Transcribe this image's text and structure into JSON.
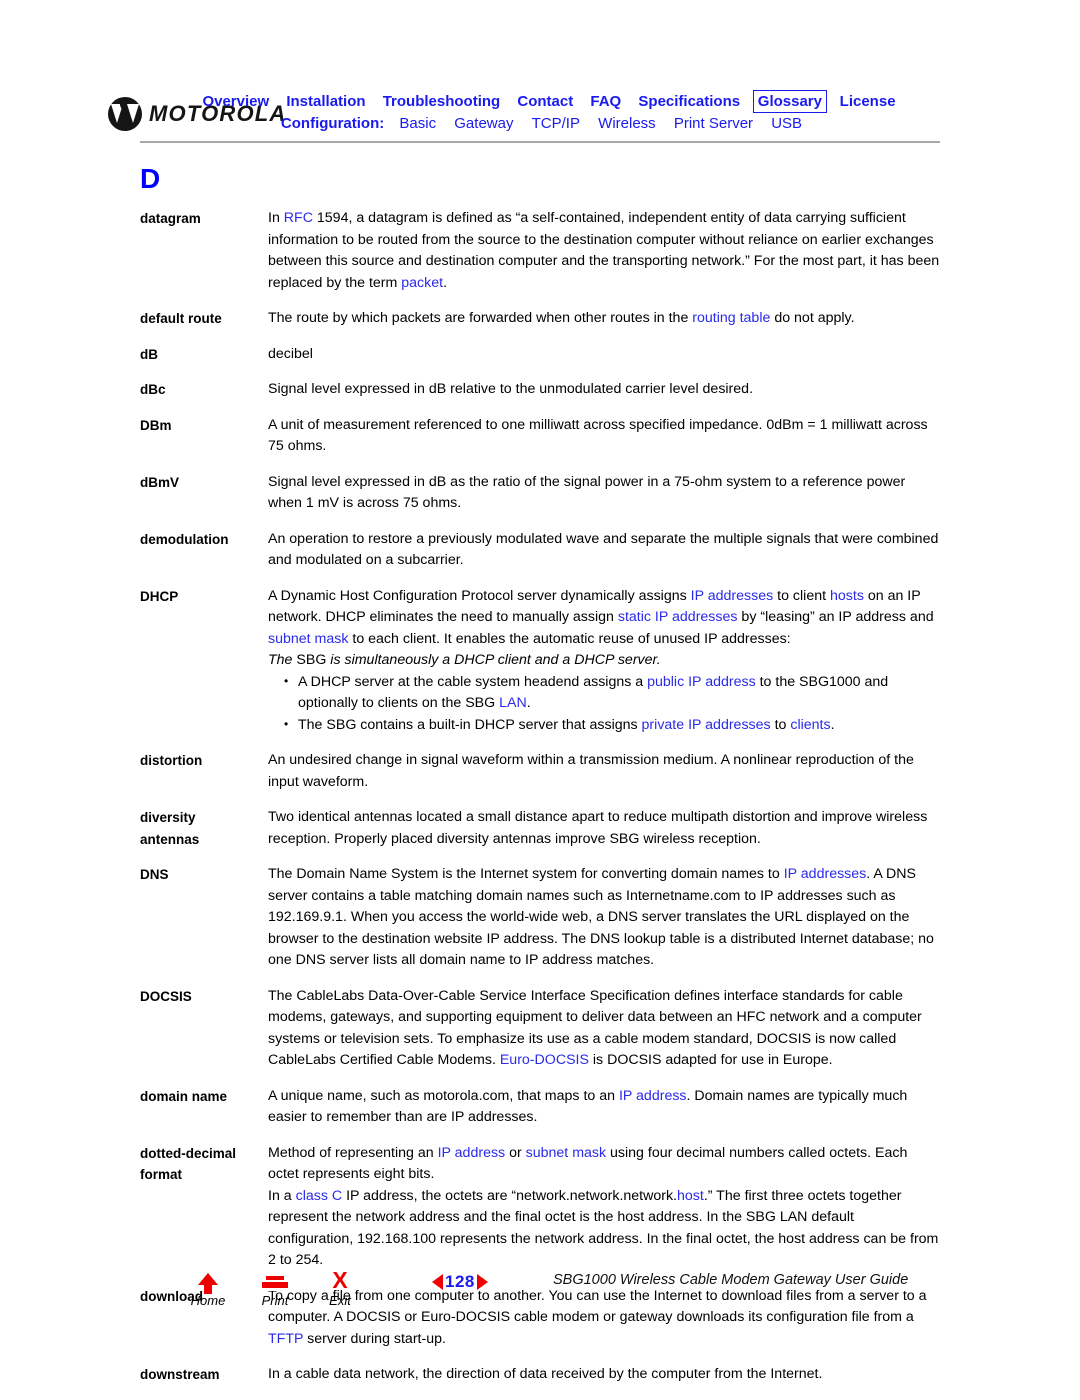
{
  "header": {
    "brand": "MOTOROLA",
    "nav_primary": [
      {
        "label": "Overview",
        "boxed": false
      },
      {
        "label": "Installation",
        "boxed": false
      },
      {
        "label": "Troubleshooting",
        "boxed": false
      },
      {
        "label": "Contact",
        "boxed": false
      },
      {
        "label": "FAQ",
        "boxed": false
      },
      {
        "label": "Specifications",
        "boxed": false
      },
      {
        "label": "Glossary",
        "boxed": true
      },
      {
        "label": "License",
        "boxed": false
      }
    ],
    "nav_secondary_label": "Configuration:",
    "nav_secondary": [
      {
        "label": "Basic"
      },
      {
        "label": "Gateway"
      },
      {
        "label": "TCP/IP"
      },
      {
        "label": "Wireless"
      },
      {
        "label": "Print Server"
      },
      {
        "label": "USB"
      }
    ],
    "link_color": "#1a1aee"
  },
  "content": {
    "letter_heading": "D",
    "entries": [
      {
        "term_lines": [
          "datagram"
        ],
        "blocks": [
          {
            "type": "paragraph",
            "runs": [
              {
                "t": "In "
              },
              {
                "t": "RFC",
                "link": true
              },
              {
                "t": " 1594, a datagram is defined as “a self-contained, independent entity of data carrying sufficient information to be routed from the source to the destination computer without reliance on earlier exchanges between this source and destination computer and the transporting network.” For the most part, it has been replaced by the term "
              },
              {
                "t": "packet",
                "link": true
              },
              {
                "t": "."
              }
            ]
          }
        ]
      },
      {
        "term_lines": [
          "default route"
        ],
        "blocks": [
          {
            "type": "paragraph",
            "runs": [
              {
                "t": "The route by which packets are forwarded when other routes in the "
              },
              {
                "t": "routing table",
                "link": true
              },
              {
                "t": " do not apply."
              }
            ]
          }
        ]
      },
      {
        "term_lines": [
          "dB"
        ],
        "blocks": [
          {
            "type": "paragraph",
            "runs": [
              {
                "t": "decibel"
              }
            ]
          }
        ]
      },
      {
        "term_lines": [
          "dBc"
        ],
        "blocks": [
          {
            "type": "paragraph",
            "runs": [
              {
                "t": "Signal level expressed in dB relative to the unmodulated carrier level desired."
              }
            ]
          }
        ]
      },
      {
        "term_lines": [
          "DBm"
        ],
        "blocks": [
          {
            "type": "paragraph",
            "runs": [
              {
                "t": "A unit of measurement referenced to one milliwatt across specified impedance. 0dBm = 1 milliwatt across 75 ohms."
              }
            ]
          }
        ]
      },
      {
        "term_lines": [
          "dBmV"
        ],
        "blocks": [
          {
            "type": "paragraph",
            "runs": [
              {
                "t": "Signal level expressed in dB as the ratio of the signal power in a 75-ohm system to a reference power when 1 mV is across 75 ohms."
              }
            ]
          }
        ]
      },
      {
        "term_lines": [
          "demodulation"
        ],
        "blocks": [
          {
            "type": "paragraph",
            "runs": [
              {
                "t": "An operation to restore a previously modulated wave and separate the multiple signals that were combined and modulated on a subcarrier."
              }
            ]
          }
        ]
      },
      {
        "term_lines": [
          "DHCP"
        ],
        "blocks": [
          {
            "type": "paragraph",
            "runs": [
              {
                "t": "A Dynamic Host Configuration Protocol server dynamically assigns "
              },
              {
                "t": "IP addresses",
                "link": true
              },
              {
                "t": " to client "
              },
              {
                "t": "hosts",
                "link": true
              },
              {
                "t": " on an IP network. DHCP eliminates the need to manually assign "
              },
              {
                "t": "static IP addresses",
                "link": true
              },
              {
                "t": " by “leasing” an IP address and "
              },
              {
                "t": "subnet mask",
                "link": true
              },
              {
                "t": " to each client. It enables the automatic reuse of unused IP addresses:"
              }
            ]
          },
          {
            "type": "paragraph",
            "runs": [
              {
                "t": "The ",
                "italic": true
              },
              {
                "t": "SBG"
              },
              {
                "t": " is simultaneously a DHCP client and a DHCP server.",
                "italic": true
              }
            ]
          },
          {
            "type": "bullets",
            "items": [
              {
                "runs": [
                  {
                    "t": "A DHCP server at the cable system headend assigns a "
                  },
                  {
                    "t": "public IP address",
                    "link": true
                  },
                  {
                    "t": " to the SBG1000 and optionally to clients on the SBG "
                  },
                  {
                    "t": "LAN",
                    "link": true
                  },
                  {
                    "t": "."
                  }
                ]
              },
              {
                "runs": [
                  {
                    "t": "The SBG contains a built-in DHCP server that assigns "
                  },
                  {
                    "t": "private IP addresses",
                    "link": true
                  },
                  {
                    "t": " to "
                  },
                  {
                    "t": "clients",
                    "link": true
                  },
                  {
                    "t": "."
                  }
                ]
              }
            ]
          }
        ]
      },
      {
        "term_lines": [
          "distortion"
        ],
        "blocks": [
          {
            "type": "paragraph",
            "runs": [
              {
                "t": "An undesired change in signal waveform within a transmission medium. A nonlinear reproduction of the input waveform."
              }
            ]
          }
        ]
      },
      {
        "term_lines": [
          "diversity",
          "antennas"
        ],
        "blocks": [
          {
            "type": "paragraph",
            "runs": [
              {
                "t": "Two identical antennas located a small distance apart to reduce multipath distortion and improve wireless reception. Properly placed diversity antennas improve SBG wireless reception."
              }
            ]
          }
        ]
      },
      {
        "term_lines": [
          "DNS"
        ],
        "blocks": [
          {
            "type": "paragraph",
            "runs": [
              {
                "t": "The Domain Name System is the Internet system for converting domain names to "
              },
              {
                "t": "IP addresses",
                "link": true
              },
              {
                "t": ". A DNS server contains a table matching domain names such as Internetname.com to IP addresses such as 192.169.9.1. When you access the world-wide web, a DNS server translates the URL displayed on the browser to the destination website IP address. The DNS lookup table is a distributed Internet database; no one DNS server lists all domain name to IP address matches."
              }
            ]
          }
        ]
      },
      {
        "term_lines": [
          "DOCSIS"
        ],
        "blocks": [
          {
            "type": "paragraph",
            "runs": [
              {
                "t": "The CableLabs Data-Over-Cable Service Interface Specification defines interface standards for cable modems, gateways, and supporting equipment to deliver data between an HFC network and a computer systems or television sets. To emphasize its use as a cable modem standard, DOCSIS is now called CableLabs Certified Cable Modems. "
              },
              {
                "t": "Euro-DOCSIS",
                "link": true
              },
              {
                "t": " is DOCSIS adapted for use in Europe."
              }
            ]
          }
        ]
      },
      {
        "term_lines": [
          "domain name"
        ],
        "blocks": [
          {
            "type": "paragraph",
            "runs": [
              {
                "t": "A unique name, such as motorola.com, that maps to an "
              },
              {
                "t": "IP address",
                "link": true
              },
              {
                "t": ". Domain names are typically much easier to remember than are IP addresses."
              }
            ]
          }
        ]
      },
      {
        "term_lines": [
          "dotted-decimal",
          "format"
        ],
        "blocks": [
          {
            "type": "paragraph",
            "runs": [
              {
                "t": "Method of representing an "
              },
              {
                "t": "IP address",
                "link": true
              },
              {
                "t": " or "
              },
              {
                "t": "subnet mask",
                "link": true
              },
              {
                "t": " using four decimal numbers called octets. Each octet represents eight bits."
              }
            ]
          },
          {
            "type": "paragraph",
            "runs": [
              {
                "t": "In a "
              },
              {
                "t": "class C",
                "link": true
              },
              {
                "t": " IP address, the octets are “network.network.network."
              },
              {
                "t": "host",
                "link": true
              },
              {
                "t": ".” The first three octets together represent the network address and the final octet is the host address. In the SBG LAN default configuration, 192.168.100 represents the network address. In the final octet, the host address can be from 2 to 254."
              }
            ]
          }
        ]
      },
      {
        "term_lines": [
          "download"
        ],
        "blocks": [
          {
            "type": "paragraph",
            "runs": [
              {
                "t": "To copy a file from one computer to another. You can use the Internet to download files from a server to a computer. A DOCSIS or Euro-DOCSIS cable modem or gateway downloads its configuration file from a "
              },
              {
                "t": "TFTP",
                "link": true
              },
              {
                "t": " server during start-up."
              }
            ]
          }
        ]
      },
      {
        "term_lines": [
          "downstream"
        ],
        "blocks": [
          {
            "type": "paragraph",
            "runs": [
              {
                "t": "In a cable data network, the direction of data received by the computer from the Internet."
              }
            ]
          }
        ]
      }
    ]
  },
  "footer": {
    "buttons": [
      {
        "icon": "home-icon",
        "label": "Home"
      },
      {
        "icon": "print-icon",
        "label": "Print"
      },
      {
        "icon": "exit-icon",
        "label": "Exit"
      }
    ],
    "page_number": "128",
    "guide_title": "SBG1000 Wireless Cable Modem Gateway User Guide",
    "arrow_color": "#ee0000",
    "page_number_color": "#1a1aee"
  }
}
